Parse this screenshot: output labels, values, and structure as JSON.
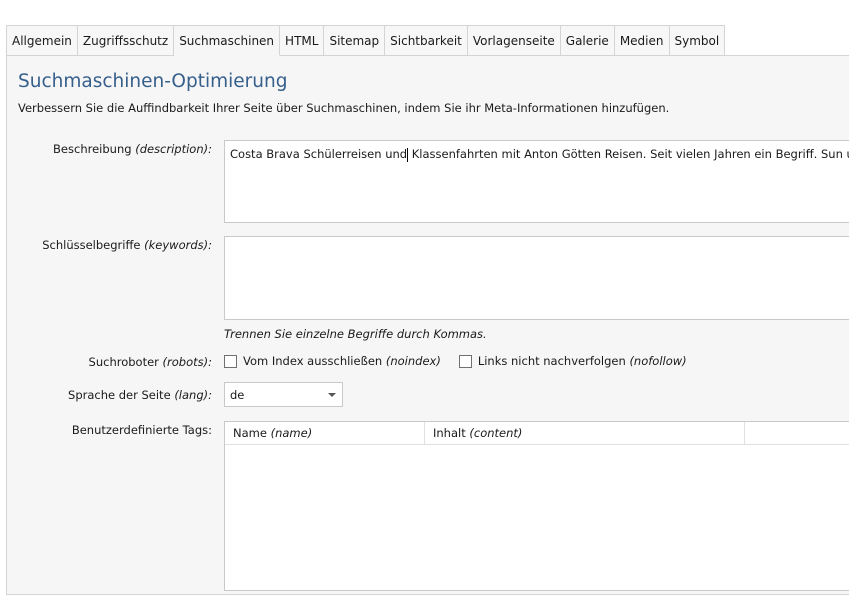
{
  "tabs": [
    "Allgemein",
    "Zugriffsschutz",
    "Suchmaschinen",
    "HTML",
    "Sitemap",
    "Sichtbarkeit",
    "Vorlagenseite",
    "Galerie",
    "Medien",
    "Symbol"
  ],
  "active_tab": "Suchmaschinen",
  "section": {
    "title": "Suchmaschinen-Optimierung",
    "subtitle": "Verbessern Sie die Auffindbarkeit Ihrer Seite über Suchmaschinen, indem Sie ihr Meta-Informationen hinzufügen."
  },
  "description": {
    "label": "Beschreibung",
    "label_hint": "(description):",
    "value_before_cursor": "Costa Brava Schülerreisen und",
    "value_after_cursor": " Klassenfahrten mit Anton Götten Reisen. Seit vielen Jahren ein Begriff.  Sun und Fun ist"
  },
  "keywords": {
    "label": "Schlüsselbegriffe",
    "label_hint": "(keywords):",
    "value": "",
    "hint": "Trennen Sie einzelne Begriffe durch Kommas."
  },
  "robots": {
    "label": "Suchroboter",
    "label_hint": "(robots):",
    "noindex_label": "Vom Index ausschließen",
    "noindex_hint": "(noindex)",
    "nofollow_label": "Links nicht nachverfolgen",
    "nofollow_hint": "(nofollow)"
  },
  "lang": {
    "label": "Sprache der Seite",
    "label_hint": "(lang):",
    "value": "de"
  },
  "custom_tags": {
    "label": "Benutzerdefinierte Tags:",
    "col_name": "Name",
    "col_name_hint": "(name)",
    "col_content": "Inhalt",
    "col_content_hint": "(content)"
  }
}
